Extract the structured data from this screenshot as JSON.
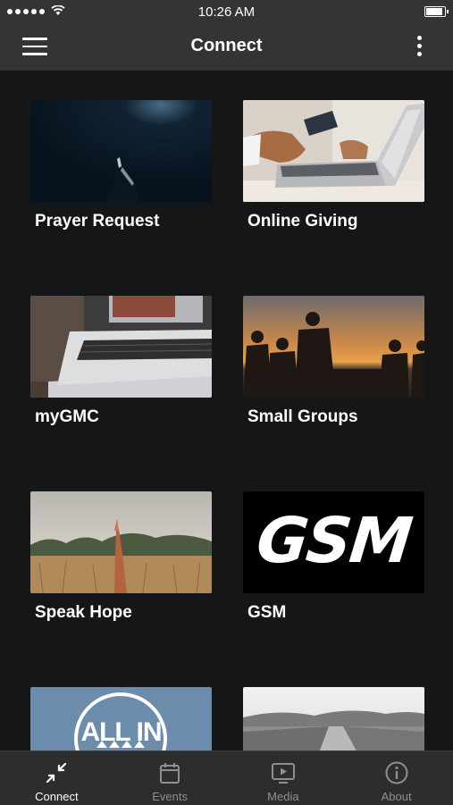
{
  "status_bar": {
    "time": "10:26 AM"
  },
  "header": {
    "title": "Connect",
    "menu_icon": "hamburger-icon",
    "more_icon": "more-vertical-icon"
  },
  "tiles": [
    {
      "label": "Prayer Request"
    },
    {
      "label": "Online Giving"
    },
    {
      "label": "myGMC"
    },
    {
      "label": "Small Groups"
    },
    {
      "label": "Speak Hope"
    },
    {
      "label": "GSM",
      "image_text": "GSM"
    },
    {
      "label": "",
      "image_text": "ALL IN"
    },
    {
      "label": ""
    }
  ],
  "tabs": [
    {
      "label": "Connect",
      "icon": "connect-icon",
      "active": true
    },
    {
      "label": "Events",
      "icon": "calendar-icon",
      "active": false
    },
    {
      "label": "Media",
      "icon": "media-icon",
      "active": false
    },
    {
      "label": "About",
      "icon": "info-icon",
      "active": false
    }
  ],
  "colors": {
    "background": "#151618",
    "bar": "#333436",
    "tab_inactive": "#8e8f91"
  }
}
